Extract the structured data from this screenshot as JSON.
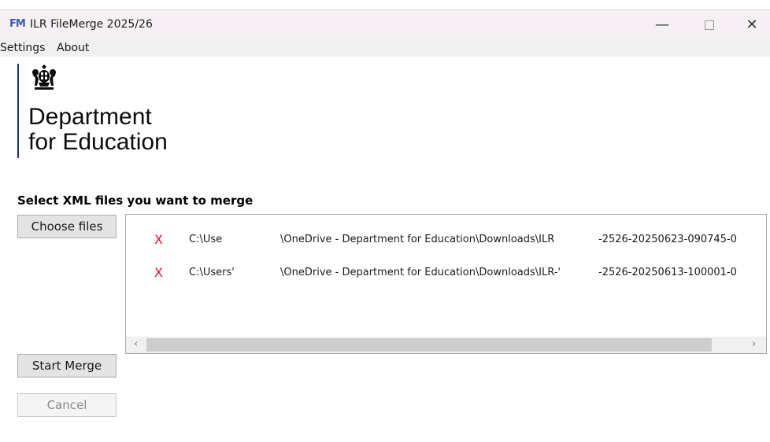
{
  "window": {
    "icon_text": "FM",
    "title": "ILR FileMerge 2025/26",
    "minimize_glyph": "—",
    "close_glyph": "✕"
  },
  "menu": {
    "items": [
      {
        "label": "Settings"
      },
      {
        "label": "About"
      }
    ]
  },
  "logo": {
    "line1": "Department",
    "line2": "for Education",
    "colors": {
      "bar": "#1e3570"
    }
  },
  "main": {
    "section_label": "Select XML files you want to merge",
    "choose_files_label": "Choose files",
    "start_merge_label": "Start Merge",
    "cancel_label": "Cancel",
    "files": [
      {
        "remove_glyph": "X",
        "path_start": "C:\\Use",
        "path_mid": "\\OneDrive - Department for Education\\Downloads\\ILR",
        "path_end": "-2526-20250623-090745-0"
      },
      {
        "remove_glyph": "X",
        "path_start": "C:\\Users'",
        "path_mid": "\\OneDrive - Department for Education\\Downloads\\ILR-'",
        "path_end": "-2526-20250613-100001-0"
      }
    ],
    "scroll_left_glyph": "‹",
    "scroll_right_glyph": "›"
  },
  "colors": {
    "remove": "#e81123",
    "titlebar": "#f6f0f4"
  }
}
